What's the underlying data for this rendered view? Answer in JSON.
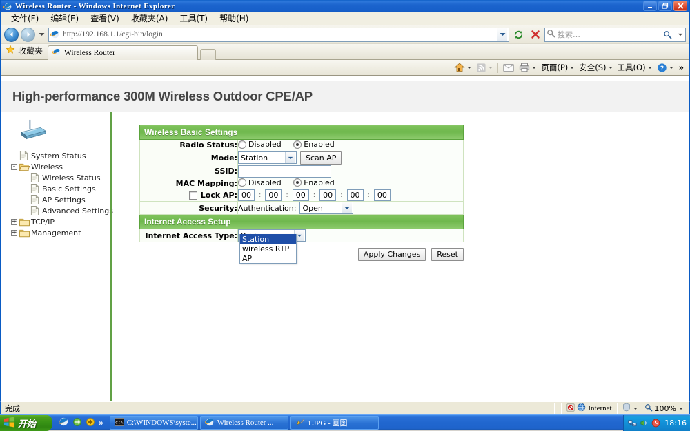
{
  "window": {
    "title": "Wireless Router - Windows Internet Explorer",
    "controls": {
      "minimize": "_",
      "restore": "❐",
      "close": "✕"
    }
  },
  "menubar": {
    "items": [
      {
        "label": "文件(F)",
        "name": "menu-file"
      },
      {
        "label": "编辑(E)",
        "name": "menu-edit"
      },
      {
        "label": "查看(V)",
        "name": "menu-view"
      },
      {
        "label": "收藏夹(A)",
        "name": "menu-favorites"
      },
      {
        "label": "工具(T)",
        "name": "menu-tools"
      },
      {
        "label": "帮助(H)",
        "name": "menu-help"
      }
    ]
  },
  "navbar": {
    "url": "http://192.168.1.1/cgi-bin/login",
    "search_placeholder": "搜索…"
  },
  "favorites": {
    "label": "收藏夹"
  },
  "tabs": [
    {
      "label": "Wireless Router"
    }
  ],
  "commandbar": {
    "items": [
      {
        "label": "页面(P)",
        "name": "cmd-page"
      },
      {
        "label": "安全(S)",
        "name": "cmd-safety"
      },
      {
        "label": "工具(O)",
        "name": "cmd-tools"
      }
    ],
    "overflow": "»"
  },
  "page": {
    "title": "High-performance 300M Wireless Outdoor CPE/AP",
    "accent_green": "#6fb84d"
  },
  "sidebar": {
    "items": [
      {
        "label": "System Status",
        "icon": "page-icon",
        "level": 1,
        "expander": ""
      },
      {
        "label": "Wireless",
        "icon": "folder-open-icon",
        "level": 0,
        "expander": "-"
      },
      {
        "label": "Wireless Status",
        "icon": "page-icon",
        "level": 2,
        "expander": ""
      },
      {
        "label": "Basic Settings",
        "icon": "page-icon",
        "level": 2,
        "expander": ""
      },
      {
        "label": "AP Settings",
        "icon": "page-icon",
        "level": 2,
        "expander": ""
      },
      {
        "label": "Advanced Settings",
        "icon": "page-icon",
        "level": 2,
        "expander": ""
      },
      {
        "label": "TCP/IP",
        "icon": "folder-icon",
        "level": 0,
        "expander": "+"
      },
      {
        "label": "Management",
        "icon": "folder-icon",
        "level": 0,
        "expander": "+"
      }
    ]
  },
  "form": {
    "section_wireless": "Wireless Basic Settings",
    "section_internet": "Internet Access Setup",
    "radio_status": {
      "label": "Radio Status:",
      "disabled_label": "Disabled",
      "enabled_label": "Enabled",
      "selected": "Enabled"
    },
    "mode": {
      "label": "Mode:",
      "value": "Station",
      "options": [
        "Station",
        "wireless RTP",
        "AP"
      ],
      "open": true,
      "highlighted": "Station",
      "scan_button": "Scan AP"
    },
    "ssid": {
      "label": "SSID:",
      "value": ""
    },
    "mac_mapping": {
      "label": "MAC Mapping:",
      "disabled_label": "Disabled",
      "enabled_label": "Enabled",
      "selected": "Enabled"
    },
    "lock_ap": {
      "label": "Lock AP:",
      "checked": false,
      "octets": [
        "00",
        "00",
        "00",
        "00",
        "00",
        "00"
      ],
      "separator": ":"
    },
    "security": {
      "label": "Security:",
      "auth_label": "Authentication:",
      "auth_value": "Open"
    },
    "internet_access_type": {
      "label": "Internet Access Type:",
      "value": "Bridge"
    },
    "buttons": {
      "apply": "Apply Changes",
      "reset": "Reset"
    }
  },
  "statusbar": {
    "text": "完成",
    "zone": "Internet",
    "zoom": "100%"
  },
  "taskbar": {
    "start": "开始",
    "tasks": [
      {
        "label": "C:\\WINDOWS\\syste...",
        "icon": "console-icon"
      },
      {
        "label": "Wireless Router ...",
        "icon": "ie-icon"
      },
      {
        "label": "1.JPG - 画图",
        "icon": "paint-icon"
      }
    ],
    "clock": "18:16"
  }
}
